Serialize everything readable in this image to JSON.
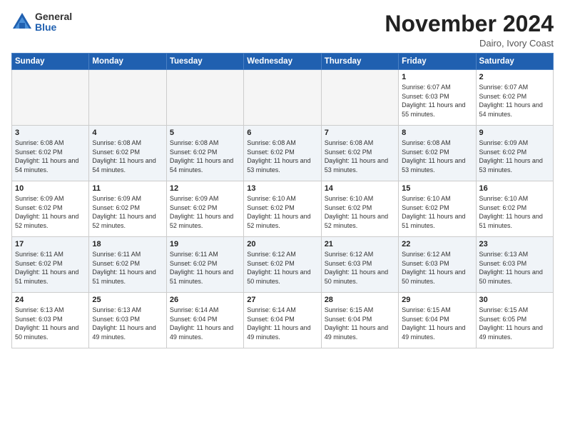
{
  "header": {
    "logo_general": "General",
    "logo_blue": "Blue",
    "month": "November 2024",
    "location": "Dairo, Ivory Coast"
  },
  "days_of_week": [
    "Sunday",
    "Monday",
    "Tuesday",
    "Wednesday",
    "Thursday",
    "Friday",
    "Saturday"
  ],
  "weeks": [
    {
      "days": [
        {
          "num": "",
          "empty": true
        },
        {
          "num": "",
          "empty": true
        },
        {
          "num": "",
          "empty": true
        },
        {
          "num": "",
          "empty": true
        },
        {
          "num": "",
          "empty": true
        },
        {
          "num": "1",
          "sunrise": "6:07 AM",
          "sunset": "6:03 PM",
          "daylight": "11 hours and 55 minutes."
        },
        {
          "num": "2",
          "sunrise": "6:07 AM",
          "sunset": "6:02 PM",
          "daylight": "11 hours and 54 minutes."
        }
      ]
    },
    {
      "days": [
        {
          "num": "3",
          "sunrise": "6:08 AM",
          "sunset": "6:02 PM",
          "daylight": "11 hours and 54 minutes."
        },
        {
          "num": "4",
          "sunrise": "6:08 AM",
          "sunset": "6:02 PM",
          "daylight": "11 hours and 54 minutes."
        },
        {
          "num": "5",
          "sunrise": "6:08 AM",
          "sunset": "6:02 PM",
          "daylight": "11 hours and 54 minutes."
        },
        {
          "num": "6",
          "sunrise": "6:08 AM",
          "sunset": "6:02 PM",
          "daylight": "11 hours and 53 minutes."
        },
        {
          "num": "7",
          "sunrise": "6:08 AM",
          "sunset": "6:02 PM",
          "daylight": "11 hours and 53 minutes."
        },
        {
          "num": "8",
          "sunrise": "6:08 AM",
          "sunset": "6:02 PM",
          "daylight": "11 hours and 53 minutes."
        },
        {
          "num": "9",
          "sunrise": "6:09 AM",
          "sunset": "6:02 PM",
          "daylight": "11 hours and 53 minutes."
        }
      ]
    },
    {
      "days": [
        {
          "num": "10",
          "sunrise": "6:09 AM",
          "sunset": "6:02 PM",
          "daylight": "11 hours and 52 minutes."
        },
        {
          "num": "11",
          "sunrise": "6:09 AM",
          "sunset": "6:02 PM",
          "daylight": "11 hours and 52 minutes."
        },
        {
          "num": "12",
          "sunrise": "6:09 AM",
          "sunset": "6:02 PM",
          "daylight": "11 hours and 52 minutes."
        },
        {
          "num": "13",
          "sunrise": "6:10 AM",
          "sunset": "6:02 PM",
          "daylight": "11 hours and 52 minutes."
        },
        {
          "num": "14",
          "sunrise": "6:10 AM",
          "sunset": "6:02 PM",
          "daylight": "11 hours and 52 minutes."
        },
        {
          "num": "15",
          "sunrise": "6:10 AM",
          "sunset": "6:02 PM",
          "daylight": "11 hours and 51 minutes."
        },
        {
          "num": "16",
          "sunrise": "6:10 AM",
          "sunset": "6:02 PM",
          "daylight": "11 hours and 51 minutes."
        }
      ]
    },
    {
      "days": [
        {
          "num": "17",
          "sunrise": "6:11 AM",
          "sunset": "6:02 PM",
          "daylight": "11 hours and 51 minutes."
        },
        {
          "num": "18",
          "sunrise": "6:11 AM",
          "sunset": "6:02 PM",
          "daylight": "11 hours and 51 minutes."
        },
        {
          "num": "19",
          "sunrise": "6:11 AM",
          "sunset": "6:02 PM",
          "daylight": "11 hours and 51 minutes."
        },
        {
          "num": "20",
          "sunrise": "6:12 AM",
          "sunset": "6:02 PM",
          "daylight": "11 hours and 50 minutes."
        },
        {
          "num": "21",
          "sunrise": "6:12 AM",
          "sunset": "6:03 PM",
          "daylight": "11 hours and 50 minutes."
        },
        {
          "num": "22",
          "sunrise": "6:12 AM",
          "sunset": "6:03 PM",
          "daylight": "11 hours and 50 minutes."
        },
        {
          "num": "23",
          "sunrise": "6:13 AM",
          "sunset": "6:03 PM",
          "daylight": "11 hours and 50 minutes."
        }
      ]
    },
    {
      "days": [
        {
          "num": "24",
          "sunrise": "6:13 AM",
          "sunset": "6:03 PM",
          "daylight": "11 hours and 50 minutes."
        },
        {
          "num": "25",
          "sunrise": "6:13 AM",
          "sunset": "6:03 PM",
          "daylight": "11 hours and 49 minutes."
        },
        {
          "num": "26",
          "sunrise": "6:14 AM",
          "sunset": "6:04 PM",
          "daylight": "11 hours and 49 minutes."
        },
        {
          "num": "27",
          "sunrise": "6:14 AM",
          "sunset": "6:04 PM",
          "daylight": "11 hours and 49 minutes."
        },
        {
          "num": "28",
          "sunrise": "6:15 AM",
          "sunset": "6:04 PM",
          "daylight": "11 hours and 49 minutes."
        },
        {
          "num": "29",
          "sunrise": "6:15 AM",
          "sunset": "6:04 PM",
          "daylight": "11 hours and 49 minutes."
        },
        {
          "num": "30",
          "sunrise": "6:15 AM",
          "sunset": "6:05 PM",
          "daylight": "11 hours and 49 minutes."
        }
      ]
    }
  ]
}
